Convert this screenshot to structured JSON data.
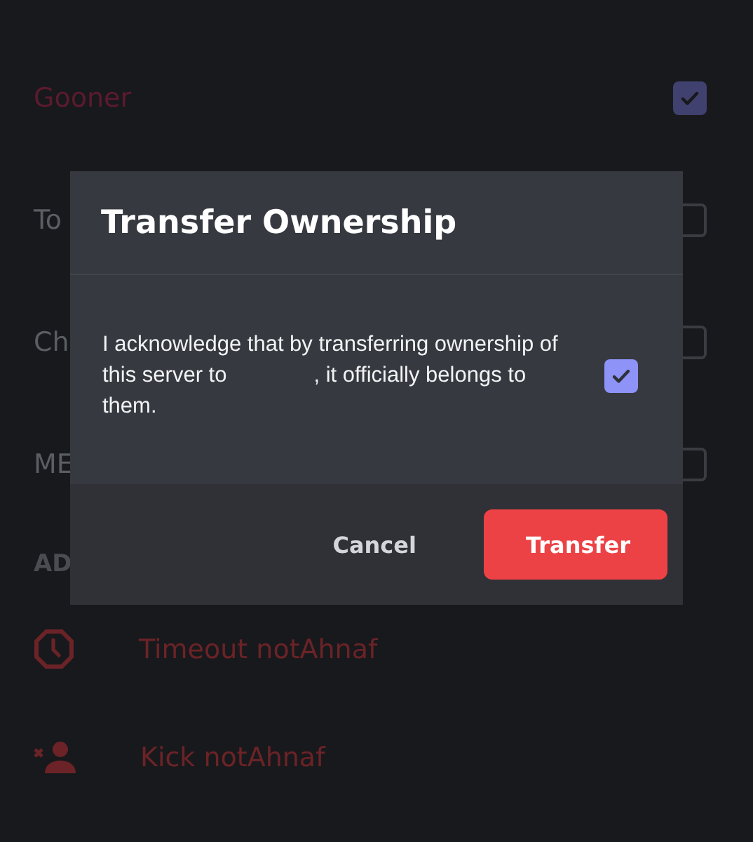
{
  "roles": [
    {
      "name": "Gooner",
      "color": "#5c1a2e",
      "checked": true
    },
    {
      "name": "To",
      "checked": false
    },
    {
      "name": "Ch",
      "checked": false
    },
    {
      "name": "ME",
      "checked": false
    }
  ],
  "section_header": "AD",
  "actions": [
    {
      "kind": "timeout",
      "label": "Timeout notAhnaf"
    },
    {
      "kind": "kick",
      "label": "Kick notAhnaf"
    }
  ],
  "dialog": {
    "title": "Transfer Ownership",
    "text_before": "I acknowledge that by transferring ownership of this server to",
    "text_after": ", it officially belongs to them.",
    "checked": true,
    "buttons": [
      {
        "kind": "secondary",
        "label": "Cancel"
      },
      {
        "kind": "danger",
        "label": "Transfer"
      }
    ]
  }
}
